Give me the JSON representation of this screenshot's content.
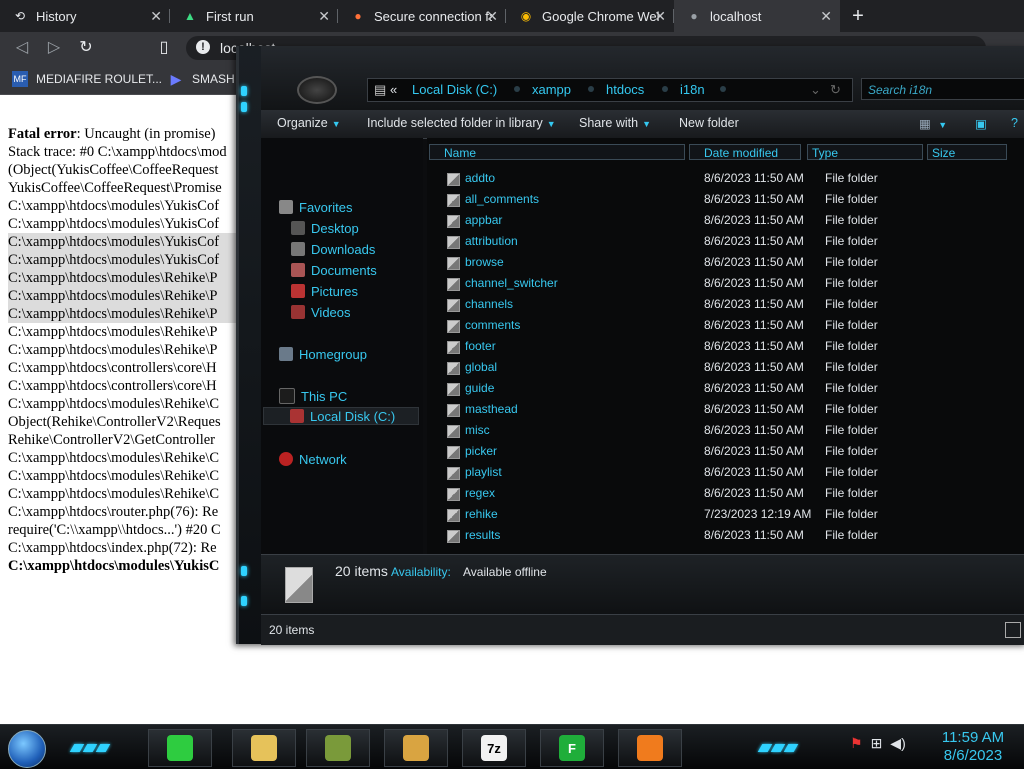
{
  "browser": {
    "tabs": [
      {
        "label": "History",
        "icon": "history-icon"
      },
      {
        "label": "First run",
        "icon": "first-run-icon"
      },
      {
        "label": "Secure connection fa",
        "icon": "firefox-icon"
      },
      {
        "label": "Google Chrome Wel",
        "icon": "chrome-icon"
      },
      {
        "label": "localhost",
        "icon": "globe-icon"
      }
    ],
    "active_tab": 4,
    "url": "localhost",
    "bookmarks": [
      {
        "label": "MEDIAFIRE ROULET...",
        "icon_text": "MF"
      },
      {
        "label": "SMASH"
      }
    ]
  },
  "page": {
    "error_lines": [
      {
        "bold": "Fatal error",
        "text": ": Uncaught (in promise)"
      },
      {
        "text": "Stack trace: #0 C:\\xampp\\htdocs\\mod"
      },
      {
        "text": "(Object(YukisCoffee\\CoffeeRequest"
      },
      {
        "text": "YukisCoffee\\CoffeeRequest\\Promise"
      },
      {
        "text": "C:\\xampp\\htdocs\\modules\\YukisCof"
      },
      {
        "text": "C:\\xampp\\htdocs\\modules\\YukisCof"
      },
      {
        "text": "C:\\xampp\\htdocs\\modules\\YukisCof",
        "hl": true
      },
      {
        "text": "C:\\xampp\\htdocs\\modules\\YukisCof",
        "hl": true
      },
      {
        "text": "C:\\xampp\\htdocs\\modules\\Rehike\\P",
        "hl": true
      },
      {
        "text": "C:\\xampp\\htdocs\\modules\\Rehike\\P",
        "hl": true
      },
      {
        "text": "C:\\xampp\\htdocs\\modules\\Rehike\\P",
        "hl": true
      },
      {
        "text": "C:\\xampp\\htdocs\\modules\\Rehike\\P"
      },
      {
        "text": "C:\\xampp\\htdocs\\modules\\Rehike\\P"
      },
      {
        "text": "C:\\xampp\\htdocs\\controllers\\core\\H"
      },
      {
        "text": "C:\\xampp\\htdocs\\controllers\\core\\H"
      },
      {
        "text": "C:\\xampp\\htdocs\\modules\\Rehike\\C"
      },
      {
        "text": "Object(Rehike\\ControllerV2\\Reques"
      },
      {
        "text": "Rehike\\ControllerV2\\GetController"
      },
      {
        "text": "C:\\xampp\\htdocs\\modules\\Rehike\\C"
      },
      {
        "text": "C:\\xampp\\htdocs\\modules\\Rehike\\C"
      },
      {
        "text": "C:\\xampp\\htdocs\\modules\\Rehike\\C"
      },
      {
        "text": "C:\\xampp\\htdocs\\router.php(76): Re"
      },
      {
        "text": "require('C:\\\\xampp\\\\htdocs...') #20 C"
      },
      {
        "text": "C:\\xampp\\htdocs\\index.php(72): Re"
      },
      {
        "bold": "C:\\xampp\\htdocs\\modules\\YukisC",
        "text": ""
      }
    ]
  },
  "explorer": {
    "breadcrumb": {
      "overflow": "«",
      "parts": [
        "Local Disk (C:)",
        "xampp",
        "htdocs",
        "i18n"
      ]
    },
    "search_placeholder": "Search i18n",
    "commands": {
      "organize": "Organize",
      "include": "Include selected folder in library",
      "share": "Share with",
      "new_folder": "New folder"
    },
    "nav": {
      "favorites": "Favorites",
      "desktop": "Desktop",
      "downloads": "Downloads",
      "documents": "Documents",
      "pictures": "Pictures",
      "videos": "Videos",
      "homegroup": "Homegroup",
      "this_pc": "This PC",
      "local_disk": "Local Disk (C:)",
      "network": "Network"
    },
    "columns": {
      "name": "Name",
      "date": "Date modified",
      "type": "Type",
      "size": "Size"
    },
    "files": [
      {
        "name": "addto",
        "date": "8/6/2023 11:50 AM",
        "type": "File folder"
      },
      {
        "name": "all_comments",
        "date": "8/6/2023 11:50 AM",
        "type": "File folder"
      },
      {
        "name": "appbar",
        "date": "8/6/2023 11:50 AM",
        "type": "File folder"
      },
      {
        "name": "attribution",
        "date": "8/6/2023 11:50 AM",
        "type": "File folder"
      },
      {
        "name": "browse",
        "date": "8/6/2023 11:50 AM",
        "type": "File folder"
      },
      {
        "name": "channel_switcher",
        "date": "8/6/2023 11:50 AM",
        "type": "File folder"
      },
      {
        "name": "channels",
        "date": "8/6/2023 11:50 AM",
        "type": "File folder"
      },
      {
        "name": "comments",
        "date": "8/6/2023 11:50 AM",
        "type": "File folder"
      },
      {
        "name": "footer",
        "date": "8/6/2023 11:50 AM",
        "type": "File folder"
      },
      {
        "name": "global",
        "date": "8/6/2023 11:50 AM",
        "type": "File folder"
      },
      {
        "name": "guide",
        "date": "8/6/2023 11:50 AM",
        "type": "File folder"
      },
      {
        "name": "masthead",
        "date": "8/6/2023 11:50 AM",
        "type": "File folder"
      },
      {
        "name": "misc",
        "date": "8/6/2023 11:50 AM",
        "type": "File folder"
      },
      {
        "name": "picker",
        "date": "8/6/2023 11:50 AM",
        "type": "File folder"
      },
      {
        "name": "playlist",
        "date": "8/6/2023 11:50 AM",
        "type": "File folder"
      },
      {
        "name": "regex",
        "date": "8/6/2023 11:50 AM",
        "type": "File folder"
      },
      {
        "name": "rehike",
        "date": "7/23/2023 12:19 AM",
        "type": "File folder"
      },
      {
        "name": "results",
        "date": "8/6/2023 11:50 AM",
        "type": "File folder"
      }
    ],
    "details": {
      "count": "20 items",
      "availability_label": "Availability:",
      "availability_value": "Available offline"
    },
    "status_count": "20 items"
  },
  "taskbar": {
    "apps": [
      {
        "name": "notes-app-icon",
        "text": "",
        "bg": "#2ecc40"
      },
      {
        "name": "file-explorer-icon",
        "text": "",
        "bg": "#e6c25a"
      },
      {
        "name": "transfer-app-icon",
        "text": "",
        "bg": "#7a9a3a"
      },
      {
        "name": "handshake-app-icon",
        "text": "",
        "bg": "#d9a441"
      },
      {
        "name": "sevenzip-icon",
        "text": "7z",
        "bg": "#f2f2f2"
      },
      {
        "name": "f-app-icon",
        "text": "F",
        "bg": "#1fae3a"
      },
      {
        "name": "xampp-icon",
        "text": "",
        "bg": "#f07b1d"
      }
    ],
    "clock_time": "11:59 AM",
    "clock_date": "8/6/2023"
  },
  "colors": {
    "accent": "#38c8ef",
    "chrome_bg": "#202124"
  }
}
